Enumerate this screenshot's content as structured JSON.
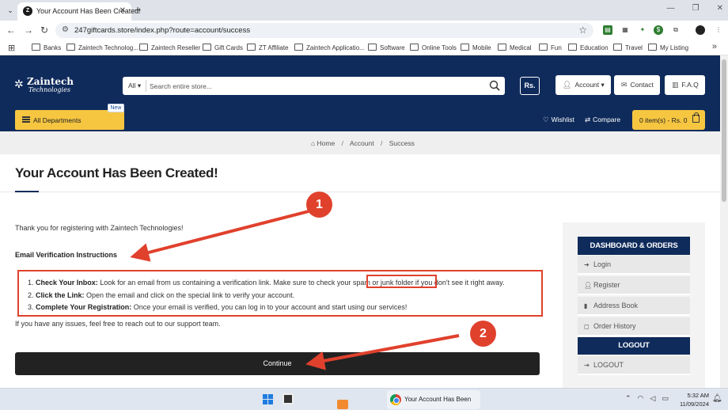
{
  "browser": {
    "tab_title": "Your Account Has Been Created!",
    "tab_favicon": "Z",
    "url": "247giftcards.store/index.php?route=account/success",
    "bookmarks": [
      "Banks",
      "Zaintech Technolog...",
      "Zaintech Reseller",
      "Gift Cards",
      "ZT Affiliate",
      "Zaintech Applicatio...",
      "Software",
      "Online Tools",
      "Mobile",
      "Medical",
      "Fun",
      "Education",
      "Travel",
      "My Listing"
    ]
  },
  "header": {
    "logo_name": "Zaintech",
    "logo_sub": "Technologies",
    "search_category": "All",
    "search_placeholder": "Search entire store...",
    "currency": "Rs.",
    "account_label": "Account",
    "contact_label": "Contact",
    "faq_label": "F.A.Q",
    "departments_label": "All Departments",
    "new_badge": "New",
    "wishlist_label": "Wishlist",
    "compare_label": "Compare",
    "cart_label": "0 item(s) - Rs. 0"
  },
  "breadcrumb": [
    "Home",
    "Account",
    "Success"
  ],
  "main": {
    "title": "Your Account Has Been Created!",
    "thanks": "Thank you for registering with Zaintech Technologies!",
    "instructions_heading": "Email Verification Instructions",
    "steps": [
      {
        "num": "1.",
        "title": "Check Your Inbox:",
        "text": " Look for an email from us containing a verification link. Make sure to check your spam or junk folder if you don't see it right away."
      },
      {
        "num": "2.",
        "title": "Click the Link:",
        "text": " Open the email and click on the special link to verify your account."
      },
      {
        "num": "3.",
        "title": "Complete Your Registration:",
        "text": " Once your email is verified, you can log in to your account and start using our services!"
      }
    ],
    "issues": "If you have any issues, feel free to reach out to our support team.",
    "continue_label": "Continue"
  },
  "sidebar": {
    "heading": "DASHBOARD & ORDERS",
    "items": [
      "Login",
      "Register",
      "Address Book",
      "Order History"
    ],
    "logout_heading": "LOGOUT",
    "logout_item": "LOGOUT"
  },
  "annotations": {
    "badge_1": "1",
    "badge_2": "2",
    "color": "#e0412d"
  },
  "taskbar": {
    "window_title": "Your Account Has Been",
    "time": "5:32 AM",
    "date": "11/09/2024"
  }
}
